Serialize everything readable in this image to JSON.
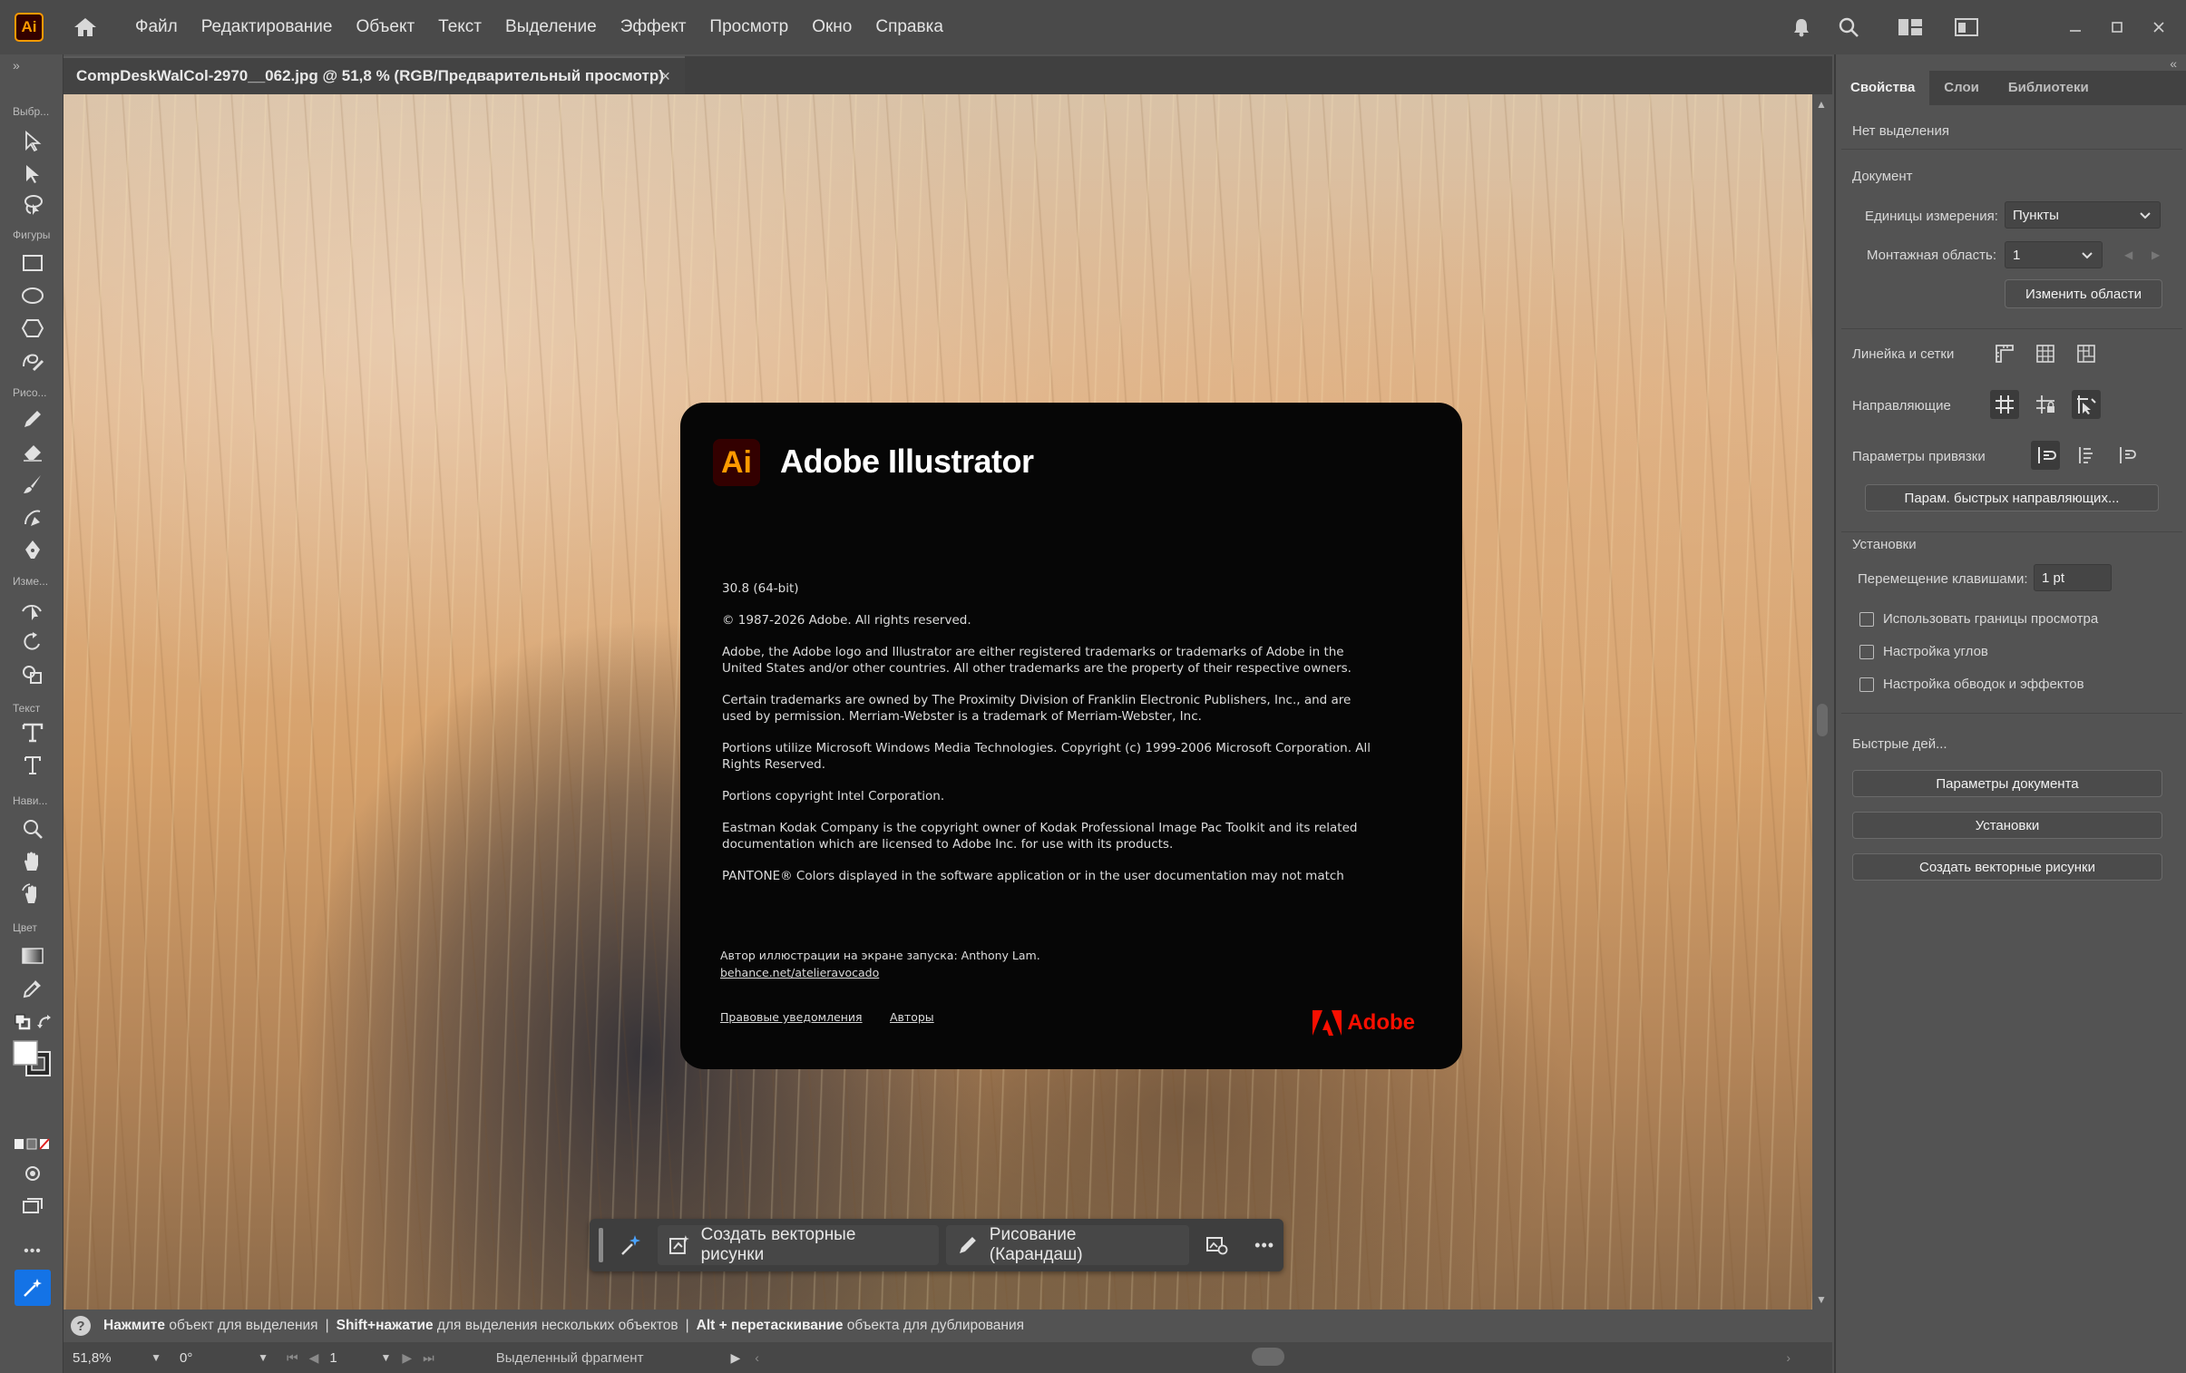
{
  "app": {
    "logo_text": "Ai",
    "menu": [
      "Файл",
      "Редактирование",
      "Объект",
      "Текст",
      "Выделение",
      "Эффект",
      "Просмотр",
      "Окно",
      "Справка"
    ],
    "window_icons": [
      "bell-icon",
      "search-icon",
      "workspace-icon",
      "panel-toggle-icon",
      "minimize-icon",
      "maximize-icon",
      "close-icon"
    ]
  },
  "toolbar": {
    "groups": {
      "select": "Выбр...",
      "shapes": "Фигуры",
      "draw": "Рисо...",
      "modify": "Изме...",
      "text": "Текст",
      "navigate": "Нави...",
      "color": "Цвет"
    },
    "more_label": "•••"
  },
  "document": {
    "tab_title": "CompDeskWalCol-2970__062.jpg @ 51,8 % (RGB/Предварительный просмотр)",
    "close_glyph": "×"
  },
  "about": {
    "logo_text": "Ai",
    "product": "Adobe Illustrator",
    "legal": [
      "30.8 (64-bit)",
      "© 1987-2026 Adobe. All rights reserved.",
      "Adobe, the Adobe logo and Illustrator are either registered trademarks or trademarks of Adobe in the United States and/or other countries. All other trademarks are the property of their respective owners.",
      "Certain trademarks are owned by The Proximity Division of Franklin Electronic Publishers, Inc., and are used by permission. Merriam-Webster is a trademark of Merriam-Webster, Inc.",
      "Portions utilize Microsoft Windows Media Technologies. Copyright (c) 1999-2006 Microsoft Corporation. All Rights Reserved.",
      "Portions copyright Intel Corporation.",
      "Eastman Kodak Company is the copyright owner of Kodak Professional Image Pac Toolkit and its related documentation which are licensed to Adobe Inc. for use with its products.",
      "PANTONE® Colors displayed in the software application or in the user documentation may not match"
    ],
    "credit": "Автор иллюстрации на экране запуска: Anthony Lam.",
    "credit_link": "behance.net/atelieravocado",
    "legal_notices_link": "Правовые уведомления",
    "authors_link": "Авторы",
    "adobe_wordmark": "Adobe",
    "adobe_red": "#fa0f00",
    "ai_orange": "#ff9a00"
  },
  "taskbar": {
    "vectorize_label": "Создать векторные рисунки",
    "pencil_label": "Рисование (Карандаш)",
    "more_label": "•••"
  },
  "status": {
    "hint_1_bold": "Нажмите",
    "hint_1": " объект для выделения",
    "sep": "|",
    "hint_2_bold": "Shift+нажатие",
    "hint_2": " для выделения нескольких объектов",
    "hint_3_bold": "Alt + перетаскивание",
    "hint_3": " объекта для дублирования",
    "zoom": "51,8%",
    "rotation": "0°",
    "artboard": "1",
    "selection_info": "Выделенный фрагмент"
  },
  "properties": {
    "tabs": [
      "Свойства",
      "Слои",
      "Библиотеки"
    ],
    "no_selection": "Нет выделения",
    "document_header": "Документ",
    "units_label": "Единицы измерения:",
    "units_value": "Пункты",
    "artboard_label": "Монтажная область:",
    "artboard_value": "1",
    "edit_artboards": "Изменить области",
    "rulers_grids": "Линейка и сетки",
    "guides": "Направляющие",
    "snap_options": "Параметры привязки",
    "smart_guides_button": "Парам. быстрых направляющих...",
    "preferences_header": "Установки",
    "keyboard_increment_label": "Перемещение клавишами:",
    "keyboard_increment_value": "1 pt",
    "check_preview_bounds": "Использовать границы просмотра",
    "check_corners": "Настройка углов",
    "check_strokes": "Настройка обводок и эффектов",
    "quick_actions_header": "Быстрые дей...",
    "doc_setup_button": "Параметры документа",
    "preferences_button": "Установки",
    "vectorize_button": "Создать векторные рисунки"
  }
}
